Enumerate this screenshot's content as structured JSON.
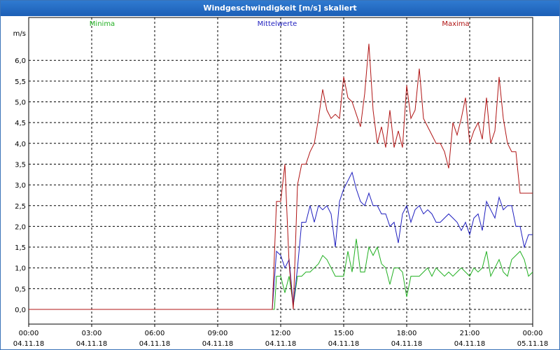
{
  "window": {
    "title": "Windgeschwindigkeit [m/s] skaliert"
  },
  "chart_data": {
    "type": "line",
    "title": "Windgeschwindigkeit [m/s] skaliert",
    "ylabel": "m/s",
    "ylim": [
      0,
      6.6
    ],
    "xlim_hours": [
      0,
      24
    ],
    "grid": true,
    "y_ticks": [
      "0,0",
      "0,5",
      "1,0",
      "1,5",
      "2,0",
      "2,5",
      "3,0",
      "3,5",
      "4,0",
      "4,5",
      "5,0",
      "5,5",
      "6,0"
    ],
    "x_ticks": [
      {
        "time": "00:00",
        "date": "04.11.18"
      },
      {
        "time": "03:00",
        "date": "04.11.18"
      },
      {
        "time": "06:00",
        "date": "04.11.18"
      },
      {
        "time": "09:00",
        "date": "04.11.18"
      },
      {
        "time": "12:00",
        "date": "04.11.18"
      },
      {
        "time": "15:00",
        "date": "04.11.18"
      },
      {
        "time": "18:00",
        "date": "04.11.18"
      },
      {
        "time": "21:00",
        "date": "04.11.18"
      },
      {
        "time": "00:00",
        "date": "05.11.18"
      }
    ],
    "series": [
      {
        "name": "Minima",
        "color": "#22b022",
        "x": [
          0,
          11.7,
          11.8,
          12.0,
          12.2,
          12.4,
          12.6,
          12.8,
          13.0,
          13.2,
          13.4,
          13.6,
          13.8,
          14.0,
          14.2,
          14.4,
          14.6,
          14.8,
          15.0,
          15.2,
          15.4,
          15.6,
          15.8,
          16.0,
          16.2,
          16.4,
          16.6,
          16.8,
          17.0,
          17.2,
          17.4,
          17.6,
          17.8,
          18.0,
          18.2,
          18.4,
          18.6,
          18.8,
          19.0,
          19.2,
          19.4,
          19.6,
          19.8,
          20.0,
          20.2,
          20.4,
          20.6,
          20.8,
          21.0,
          21.2,
          21.4,
          21.6,
          21.8,
          22.0,
          22.2,
          22.4,
          22.6,
          22.8,
          23.0,
          23.2,
          23.4,
          23.6,
          23.8,
          24.0
        ],
        "values": [
          0,
          0,
          0.8,
          0.8,
          0.4,
          0.8,
          0.1,
          0.8,
          0.8,
          0.9,
          0.9,
          1.0,
          1.1,
          1.3,
          1.2,
          1.0,
          0.8,
          0.8,
          0.8,
          1.4,
          0.9,
          1.7,
          0.9,
          0.9,
          1.5,
          1.3,
          1.5,
          1.1,
          1.0,
          0.6,
          1.0,
          1.0,
          0.9,
          0.3,
          0.8,
          0.8,
          0.8,
          0.9,
          1.0,
          0.8,
          1.0,
          0.9,
          0.8,
          0.9,
          0.8,
          0.9,
          1.0,
          0.9,
          0.8,
          1.0,
          0.9,
          1.0,
          1.4,
          0.8,
          1.0,
          1.2,
          0.9,
          0.8,
          1.2,
          1.3,
          1.4,
          1.2,
          0.8,
          0.9
        ]
      },
      {
        "name": "Mittelwerte",
        "color": "#1f1fbf",
        "x": [
          0,
          11.6,
          11.8,
          12.0,
          12.2,
          12.4,
          12.6,
          12.8,
          13.0,
          13.2,
          13.4,
          13.6,
          13.8,
          14.0,
          14.2,
          14.4,
          14.6,
          14.8,
          15.0,
          15.2,
          15.4,
          15.6,
          15.8,
          16.0,
          16.2,
          16.4,
          16.6,
          16.8,
          17.0,
          17.2,
          17.4,
          17.6,
          17.8,
          18.0,
          18.2,
          18.4,
          18.6,
          18.8,
          19.0,
          19.2,
          19.4,
          19.6,
          19.8,
          20.0,
          20.2,
          20.4,
          20.6,
          20.8,
          21.0,
          21.2,
          21.4,
          21.6,
          21.8,
          22.0,
          22.2,
          22.4,
          22.6,
          22.8,
          23.0,
          23.2,
          23.4,
          23.6,
          23.8,
          24.0
        ],
        "values": [
          0,
          0,
          1.4,
          1.3,
          1.0,
          1.2,
          0.1,
          1.0,
          2.1,
          2.1,
          2.5,
          2.1,
          2.5,
          2.4,
          2.5,
          2.3,
          1.5,
          2.6,
          2.9,
          3.1,
          3.3,
          2.9,
          2.6,
          2.5,
          2.8,
          2.5,
          2.5,
          2.3,
          2.3,
          2.0,
          2.1,
          1.6,
          2.3,
          2.5,
          2.1,
          2.4,
          2.5,
          2.3,
          2.4,
          2.3,
          2.1,
          2.1,
          2.2,
          2.3,
          2.2,
          2.1,
          1.9,
          2.1,
          1.8,
          2.2,
          2.3,
          1.9,
          2.6,
          2.4,
          2.2,
          2.7,
          2.4,
          2.5,
          2.5,
          2.0,
          2.0,
          1.5,
          1.8,
          1.8
        ]
      },
      {
        "name": "Maxima",
        "color": "#b01414",
        "x": [
          0,
          11.6,
          11.8,
          12.0,
          12.2,
          12.4,
          12.6,
          12.8,
          13.0,
          13.2,
          13.4,
          13.6,
          13.8,
          14.0,
          14.2,
          14.4,
          14.6,
          14.8,
          15.0,
          15.2,
          15.4,
          15.6,
          15.8,
          16.0,
          16.2,
          16.4,
          16.6,
          16.8,
          17.0,
          17.2,
          17.4,
          17.6,
          17.8,
          18.0,
          18.2,
          18.4,
          18.6,
          18.8,
          19.0,
          19.2,
          19.4,
          19.6,
          19.8,
          20.0,
          20.2,
          20.4,
          20.6,
          20.8,
          21.0,
          21.2,
          21.4,
          21.6,
          21.8,
          22.0,
          22.2,
          22.4,
          22.6,
          22.8,
          23.0,
          23.2,
          23.4,
          23.6,
          23.8,
          24.0
        ],
        "values": [
          0,
          0,
          2.6,
          2.6,
          3.5,
          1.1,
          0.0,
          3.0,
          3.5,
          3.5,
          3.8,
          4.0,
          4.6,
          5.3,
          4.8,
          4.6,
          4.7,
          4.6,
          5.6,
          5.1,
          5.0,
          4.7,
          4.4,
          5.2,
          6.4,
          4.8,
          4.0,
          4.4,
          3.9,
          4.8,
          3.9,
          4.3,
          3.9,
          5.4,
          4.6,
          4.8,
          5.8,
          4.6,
          4.4,
          4.2,
          4.0,
          4.0,
          3.8,
          3.4,
          4.5,
          4.2,
          4.6,
          5.1,
          4.0,
          4.3,
          4.5,
          4.1,
          5.1,
          4.0,
          4.3,
          5.6,
          4.6,
          4.0,
          3.8,
          3.8,
          2.8,
          2.8,
          2.8,
          2.8
        ]
      }
    ]
  }
}
